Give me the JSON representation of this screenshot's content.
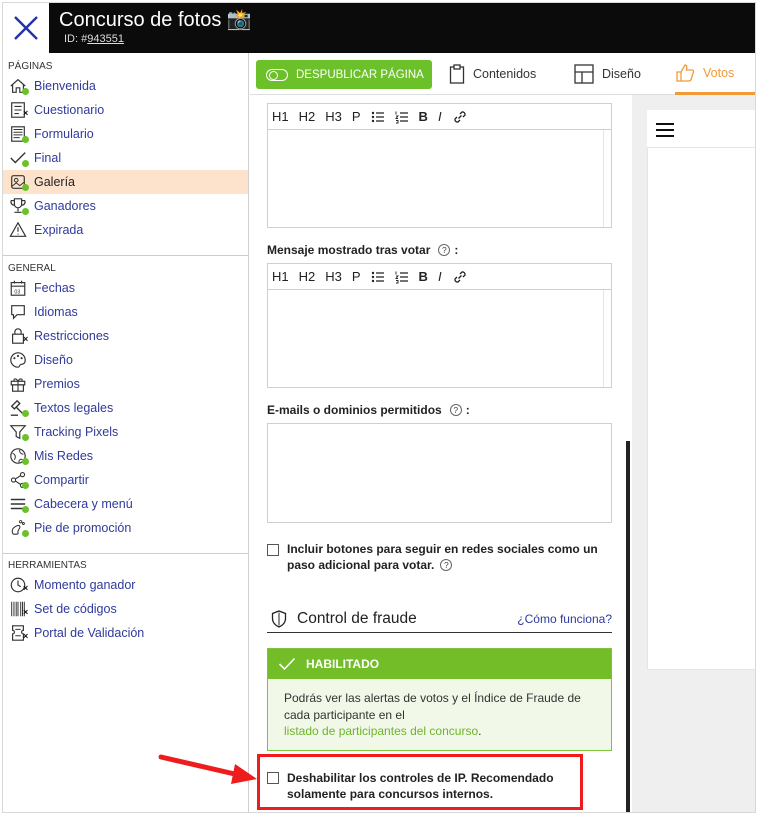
{
  "header": {
    "title": "Concurso de fotos 📸",
    "id_prefix": "ID: #",
    "id_value": "943551"
  },
  "sidebar": {
    "paginas": {
      "title": "PÁGINAS",
      "items": [
        {
          "label": "Bienvenida",
          "icon": "home-icon",
          "status": "ok"
        },
        {
          "label": "Cuestionario",
          "icon": "list-icon",
          "status": "x"
        },
        {
          "label": "Formulario",
          "icon": "form-icon",
          "status": "ok"
        },
        {
          "label": "Final",
          "icon": "check-icon",
          "status": "ok"
        },
        {
          "label": "Galería",
          "icon": "gallery-icon",
          "status": "ok",
          "active": true
        },
        {
          "label": "Ganadores",
          "icon": "trophy-icon",
          "status": "ok"
        },
        {
          "label": "Expirada",
          "icon": "warning-icon",
          "status": "none"
        }
      ]
    },
    "general": {
      "title": "GENERAL",
      "items": [
        {
          "label": "Fechas",
          "icon": "calendar-icon",
          "status": "none"
        },
        {
          "label": "Idiomas",
          "icon": "chat-icon",
          "status": "none"
        },
        {
          "label": "Restricciones",
          "icon": "lock-icon",
          "status": "x"
        },
        {
          "label": "Diseño",
          "icon": "palette-icon",
          "status": "none"
        },
        {
          "label": "Premios",
          "icon": "gift-icon",
          "status": "none"
        },
        {
          "label": "Textos legales",
          "icon": "gavel-icon",
          "status": "ok"
        },
        {
          "label": "Tracking Pixels",
          "icon": "filter-icon",
          "status": "ok"
        },
        {
          "label": "Mis Redes",
          "icon": "globe-icon",
          "status": "ok"
        },
        {
          "label": "Compartir",
          "icon": "share-icon",
          "status": "ok"
        },
        {
          "label": "Cabecera y menú",
          "icon": "menu-icon",
          "status": "ok"
        },
        {
          "label": "Pie de promoción",
          "icon": "footprint-icon",
          "status": "ok"
        }
      ]
    },
    "herramientas": {
      "title": "HERRAMIENTAS",
      "items": [
        {
          "label": "Momento ganador",
          "icon": "clock-icon",
          "status": "x"
        },
        {
          "label": "Set de códigos",
          "icon": "barcode-icon",
          "status": "x"
        },
        {
          "label": "Portal de Validación",
          "icon": "ticket-icon",
          "status": "x"
        }
      ]
    }
  },
  "tabs": {
    "publish_label": "DESPUBLICAR PÁGINA",
    "contenidos": "Contenidos",
    "diseno": "Diseño",
    "votos": "Votos"
  },
  "editor": {
    "rte_buttons": [
      "H1",
      "H2",
      "H3",
      "P"
    ],
    "rte_bold": "B",
    "rte_italic": "I",
    "msg_after_vote_label": "Mensaje mostrado tras votar",
    "allowed_emails_label": "E-mails o dominios permitidos",
    "label_suffix": ":",
    "help_glyph": "?",
    "follow_social_line1": "Incluir botones para seguir en redes sociales como un",
    "follow_social_line2": "paso adicional para votar.",
    "fraud_title": "Control de fraude",
    "fraud_link": "¿Cómo funciona?",
    "enabled_label": "HABILITADO",
    "enabled_text_line1": "Podrás ver las alertas de votos y el Índice de Fraude de",
    "enabled_text_line2": "cada participante en el",
    "enabled_text_link": "listado de participantes del concurso",
    "enabled_text_end": ".",
    "disable_ip_line1": "Deshabilitar los controles de IP. Recomendado",
    "disable_ip_line2": "solamente para concursos internos."
  },
  "colors": {
    "accent_green": "#6cc02a",
    "tab_active_orange": "#f19a38",
    "nav_link_blue": "#2f3a9a",
    "annotation_red": "#ee1c1c"
  }
}
